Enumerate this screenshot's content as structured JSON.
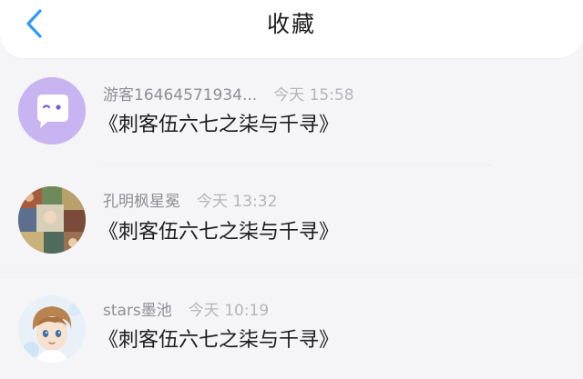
{
  "header": {
    "title": "收藏",
    "back_icon": "chevron-left-icon",
    "accent": "#2f9bf4"
  },
  "favorites": [
    {
      "avatar": "chat-bubble-face-icon",
      "avatar_color": "#c7b4f0",
      "user": "游客16464571934...",
      "time": "今天 15:58",
      "book": "《刺客伍六七之柒与千寻》"
    },
    {
      "avatar": "anime-collage-avatar",
      "user": "孔明枫星冕",
      "time": "今天 13:32",
      "book": "《刺客伍六七之柒与千寻》"
    },
    {
      "avatar": "anime-boy-avatar",
      "user": "stars墨池",
      "time": "今天 10:19",
      "book": "《刺客伍六七之柒与千寻》"
    }
  ]
}
